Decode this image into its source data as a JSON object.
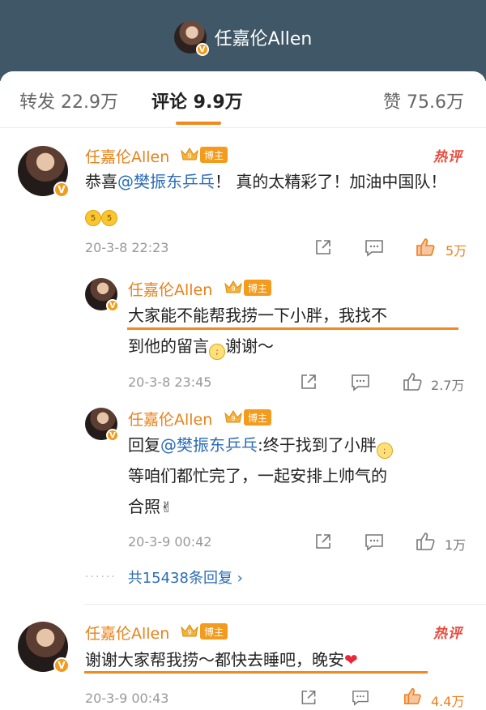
{
  "header": {
    "title": "任嘉伦Allen",
    "avatar_badge": "V"
  },
  "tabs": [
    {
      "label": "转发 22.9万"
    },
    {
      "label": "评论 9.9万"
    },
    {
      "label": "赞 75.6万"
    }
  ],
  "badges": {
    "bozhu": "博主",
    "hot": "热评",
    "crown_level": "9",
    "verified": "V"
  },
  "comments": [
    {
      "username": "任嘉伦Allen",
      "text_parts": [
        "恭喜",
        "@樊振东乒乓",
        "！ 真的太精彩了！加油中国队！"
      ],
      "emoji": "5 5",
      "time": "20-3-8 22:23",
      "likes": "5万"
    },
    {
      "username": "任嘉伦Allen",
      "text_line1": "大家能不能帮我捞一下小胖，我找不",
      "text_line2": "到他的留言",
      "text_line2_suffix": "谢谢～",
      "time": "20-3-8 23:45",
      "likes": "2.7万"
    },
    {
      "username": "任嘉伦Allen",
      "text_prefix": "回复",
      "mention": "@樊振东乒乓",
      "text_after": ":终于找到了小胖",
      "text_line2": "等咱们都忙完了，一起安排上帅气的",
      "text_line3": "合照",
      "time": "20-3-9 00:42",
      "likes": "1万"
    },
    {
      "username": "任嘉伦Allen",
      "text": "谢谢大家帮我捞～都快去睡吧，晚安",
      "time": "20-3-9 00:43",
      "likes": "4.4万"
    }
  ],
  "more_replies": {
    "label": "共15438条回复 ›"
  },
  "colors": {
    "accent": "#f08a1d",
    "link": "#2b6cb5",
    "header_bg": "#3f5766",
    "hot": "#e84a3c"
  }
}
